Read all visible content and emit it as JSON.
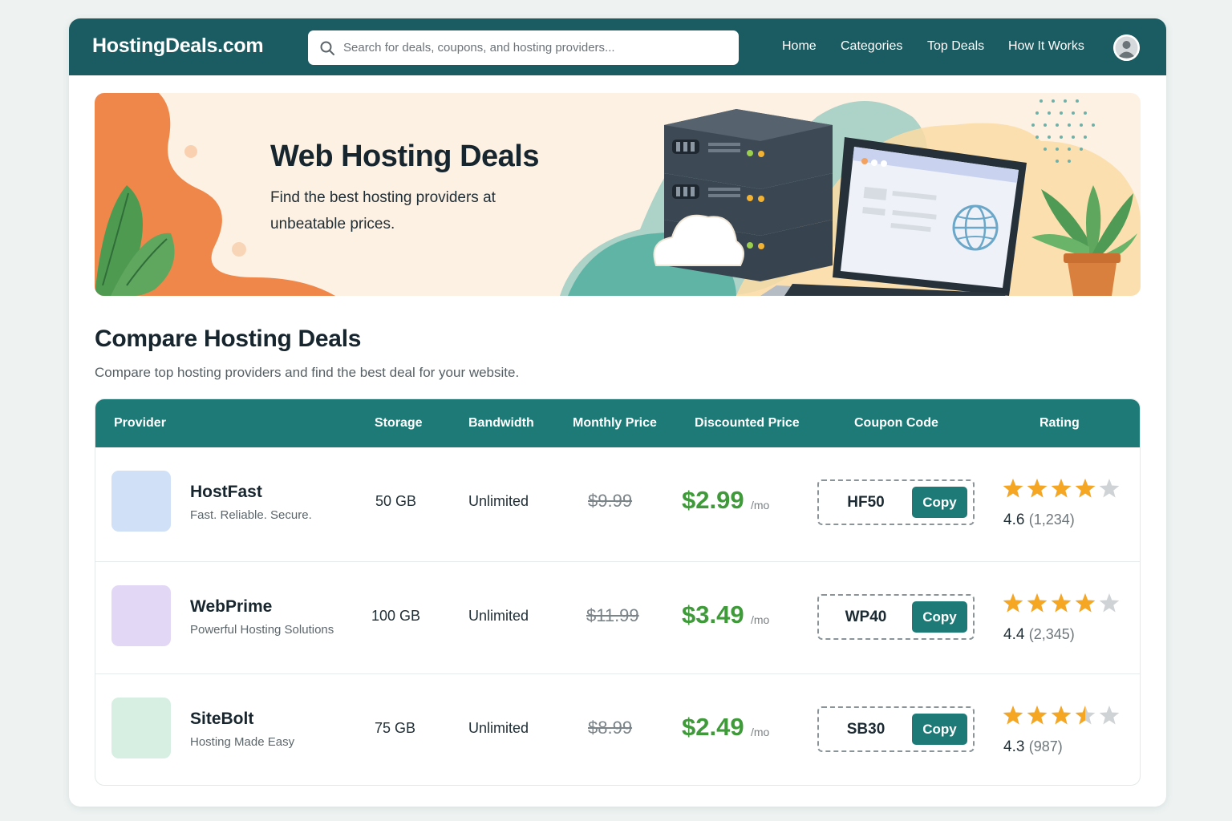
{
  "header": {
    "brand": "HostingDeals.com",
    "search_placeholder": "Search for deals, coupons, and hosting providers...",
    "nav": [
      "Home",
      "Categories",
      "Top Deals",
      "How It Works"
    ],
    "primary_color": "#1b5c62"
  },
  "hero": {
    "title": "Web Hosting Deals",
    "subtitle": "Find the best hosting providers at unbeatable prices."
  },
  "section": {
    "title": "Compare Hosting Deals",
    "subtitle": "Compare top hosting providers and find the best deal for your website."
  },
  "table": {
    "columns": [
      "Provider",
      "Storage",
      "Bandwidth",
      "Monthly Price",
      "Discounted Price",
      "Coupon Code",
      "Rating"
    ],
    "header_color": "#1e7a77",
    "rows": [
      {
        "name": "HostFast",
        "tagline": "Fast. Reliable. Secure.",
        "logo_color": "#cfe0f7",
        "storage": "50 GB",
        "bandwidth": "Unlimited",
        "monthly_price": "$9.99",
        "discounted_price": "$2.99",
        "per": "/mo",
        "coupon": "HF50",
        "copy_label": "Copy",
        "rating_value": "4.6",
        "rating_count": "(1,234)",
        "stars": 4
      },
      {
        "name": "WebPrime",
        "tagline": "Powerful Hosting Solutions",
        "logo_color": "#e2d8f5",
        "storage": "100 GB",
        "bandwidth": "Unlimited",
        "monthly_price": "$11.99",
        "discounted_price": "$3.49",
        "per": "/mo",
        "coupon": "WP40",
        "copy_label": "Copy",
        "rating_value": "4.4",
        "rating_count": "(2,345)",
        "stars": 4
      },
      {
        "name": "SiteBolt",
        "tagline": "Hosting Made Easy",
        "logo_color": "#d6efe2",
        "storage": "75 GB",
        "bandwidth": "Unlimited",
        "monthly_price": "$8.99",
        "discounted_price": "$2.49",
        "per": "/mo",
        "coupon": "SB30",
        "copy_label": "Copy",
        "rating_value": "4.3",
        "rating_count": "(987)",
        "stars": 3.5
      }
    ]
  }
}
